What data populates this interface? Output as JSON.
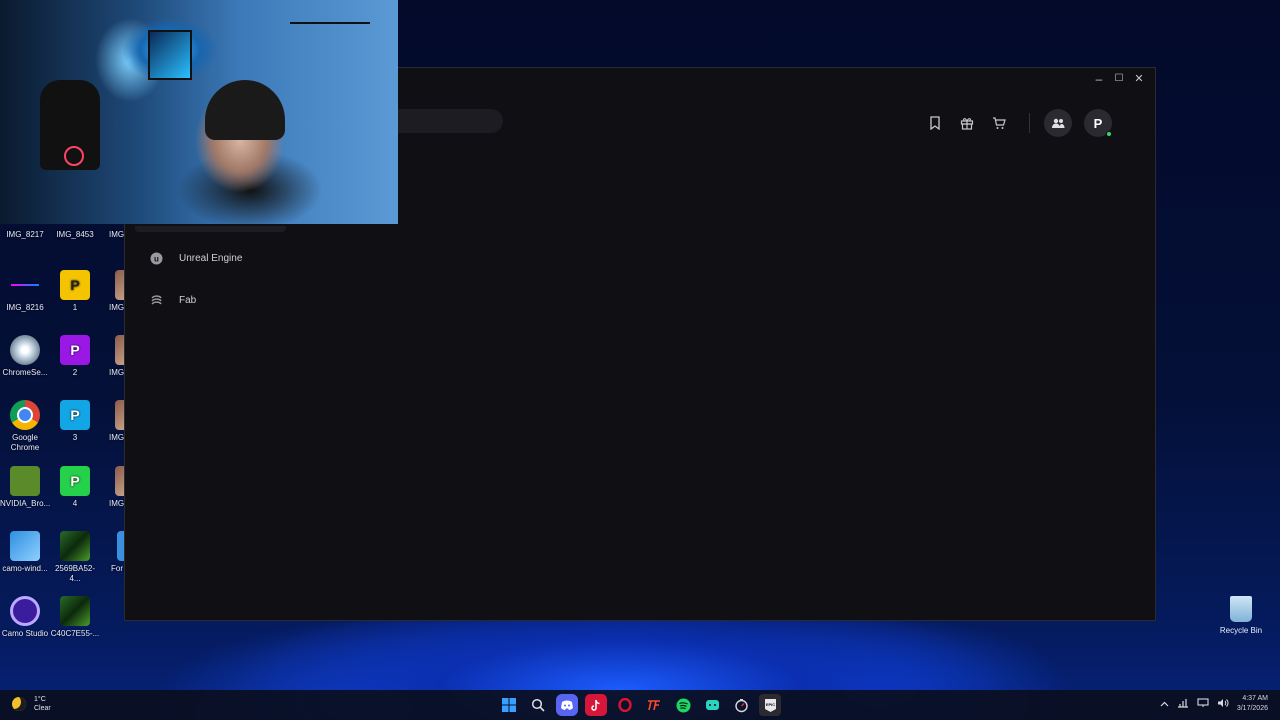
{
  "desktop": {
    "icons": [
      {
        "label": "IMG_8217"
      },
      {
        "label": "IMG_8453"
      },
      {
        "label": "IMG_"
      },
      {
        "label": "IMG_8216"
      },
      {
        "label": "1"
      },
      {
        "label": "IMG"
      },
      {
        "label": "ChromeSe..."
      },
      {
        "label": "2"
      },
      {
        "label": "IMG"
      },
      {
        "label": "Google Chrome"
      },
      {
        "label": "3"
      },
      {
        "label": "IMG"
      },
      {
        "label": "NVIDIA_Bro..."
      },
      {
        "label": "4"
      },
      {
        "label": "IMG"
      },
      {
        "label": "camo-wind..."
      },
      {
        "label": "2569BA52-4..."
      },
      {
        "label": "For"
      },
      {
        "label": "Camo Studio"
      },
      {
        "label": "C40C7E55-..."
      }
    ],
    "recycle_bin_label": "Recycle Bin"
  },
  "app": {
    "window_controls": {
      "minimize": "–",
      "maximize": "☐",
      "close": "✕"
    },
    "avatar_letter": "P",
    "nav_items": [
      {
        "label": "Unreal Engine",
        "icon": "unreal-engine-icon"
      },
      {
        "label": "Fab",
        "icon": "fab-icon"
      }
    ]
  },
  "taskbar": {
    "weather_temp": "1°C",
    "weather_desc": "Clear",
    "time": "4:37 AM",
    "date": "3/17/2026",
    "apps": [
      "windows-start",
      "search",
      "discord",
      "tiktok",
      "opera",
      "tf",
      "spotify",
      "android-studio",
      "stopwatch",
      "epic-games"
    ]
  },
  "colors": {
    "app_bg": "#101014",
    "accent_green": "#3bd16f",
    "taskbar_bg": "#0a0e1e"
  }
}
